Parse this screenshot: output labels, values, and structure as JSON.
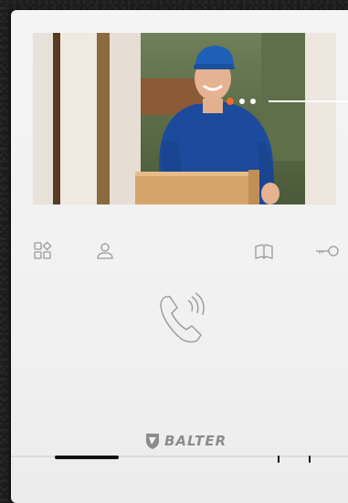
{
  "brand": {
    "name": "BALTER"
  },
  "controls": {
    "menu_icon": "apps-grid-icon",
    "user_icon": "user-icon",
    "book_icon": "book-icon",
    "key_icon": "key-icon",
    "call_icon": "handset-ringing-icon"
  },
  "colors": {
    "panel": "#f2f2f2",
    "icon_gray": "#9a9a9a",
    "accent_orange": "#f26a2e",
    "frame_dark": "#1d1d1d"
  },
  "camera_view": {
    "subject": "delivery-person-with-box",
    "indicator_colors": [
      "#f26a2e",
      "#ffffff",
      "#ffffff"
    ]
  }
}
